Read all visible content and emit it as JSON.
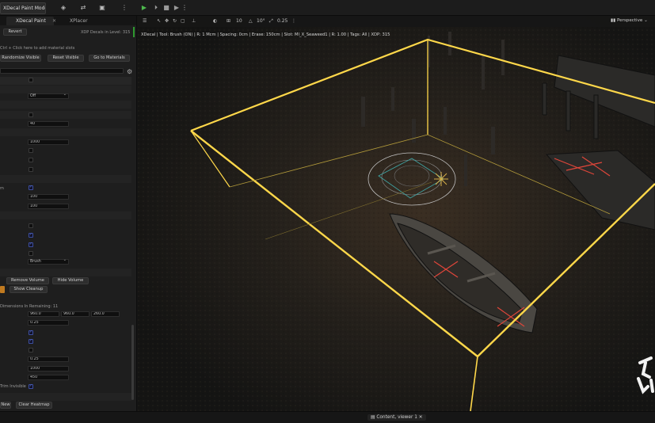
{
  "toolbar": {
    "mode_label": "XDecal Paint Mode",
    "items": [
      "select-tool-icon",
      "snap-icon",
      "camera-icon"
    ]
  },
  "tabs": [
    {
      "label": "XDecal Paint",
      "active": true
    },
    {
      "label": "XPlacer",
      "active": false
    }
  ],
  "panel": {
    "revert_label": "Revert",
    "decal_count": "XDP Decals in Level: 315",
    "hint": "Ctrl + Click here to add material slots",
    "randomize_label": "Randomize Visible",
    "reset_label": "Reset Visible",
    "goto_materials_label": "Go to Materials",
    "fields": [
      {
        "value": "Off"
      },
      {
        "value": "40"
      },
      {
        "value": "1000"
      },
      {
        "value": "100"
      },
      {
        "value": "100"
      },
      {
        "value": "Brush"
      }
    ],
    "remove_volume_label": "Remove Volume",
    "hide_volume_label": "Hide Volume",
    "show_cleanup_label": "Show Cleanup",
    "dimensions_label": "Dimensions In Remaining: 11",
    "dims": [
      "960.0",
      "960.0",
      "260.0"
    ],
    "values": [
      "0.25",
      "0.25",
      "1000",
      "450"
    ],
    "clear_heatmap_label": "Clear Heatmap",
    "new_label": "New",
    "trim_label": "Trim Invisible"
  },
  "viewport": {
    "info": "XDecal | Tool: Brush (ON) | R: 1 Mcm | Spacing: 0cm | Erase: 150cm | Slot: MI_X_Seaweed1 | R: 1.00 | Tags: All | XDP: 315",
    "perspective_label": "Perspective",
    "snap_values": [
      "10",
      "10°",
      "0.25"
    ]
  },
  "bottom": {
    "content_label": "Content, viewer 1"
  },
  "colors": {
    "volume": "#ffd84a",
    "accent_check": "#5d7ad6",
    "play": "#4db84d"
  }
}
